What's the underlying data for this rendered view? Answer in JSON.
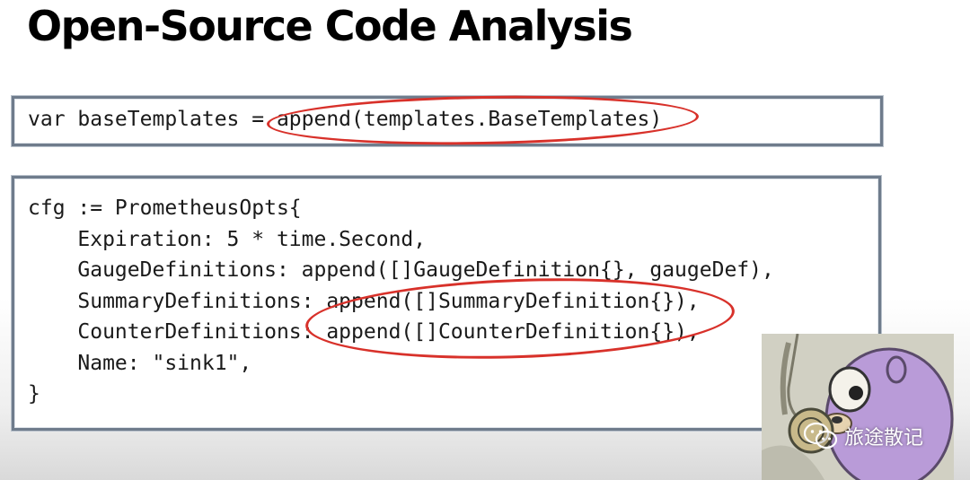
{
  "slide": {
    "title": "Open-Source Code Analysis"
  },
  "code_block_1": {
    "lines": [
      "var baseTemplates = append(templates.BaseTemplates)"
    ]
  },
  "code_block_2": {
    "lines": [
      "cfg := PrometheusOpts{",
      "    Expiration: 5 * time.Second,",
      "    GaugeDefinitions: append([]GaugeDefinition{}, gaugeDef),",
      "    SummaryDefinitions: append([]SummaryDefinition{}),",
      "    CounterDefinitions: append([]CounterDefinition{}),",
      "    Name: \"sink1\",",
      "}"
    ]
  },
  "watermark": {
    "text": "旅途散记",
    "icon": "wechat-icon"
  },
  "colors": {
    "annotation": "#d8312a",
    "box_border": "#6f7c8c",
    "mascot": "#b99bd8"
  }
}
